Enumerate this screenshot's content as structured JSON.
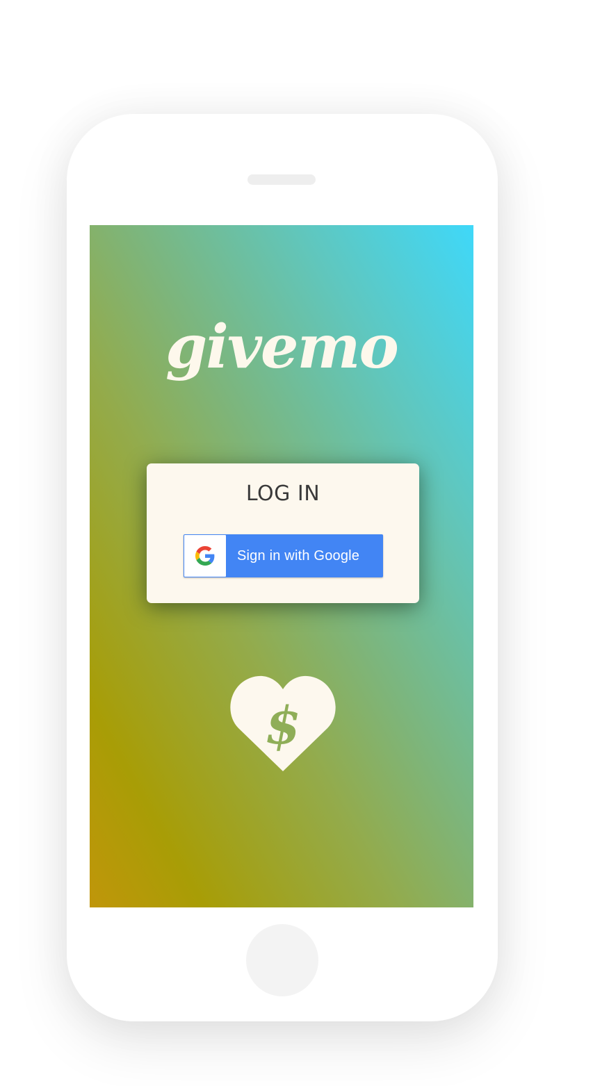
{
  "app": {
    "logo_text": "givemo"
  },
  "login_card": {
    "title": "LOG IN",
    "google_button_label": "Sign in with Google"
  },
  "icons": {
    "google": "google-g-icon",
    "heart": "heart-dollar-icon"
  },
  "colors": {
    "gradient_top_right": "#3fd8f9",
    "gradient_bottom_left": "#c0960a",
    "card_background": "#fdf8ee",
    "google_blue": "#4285f4",
    "logo_color": "#fdf8ec",
    "heart_dollar_color": "#8fae58"
  }
}
